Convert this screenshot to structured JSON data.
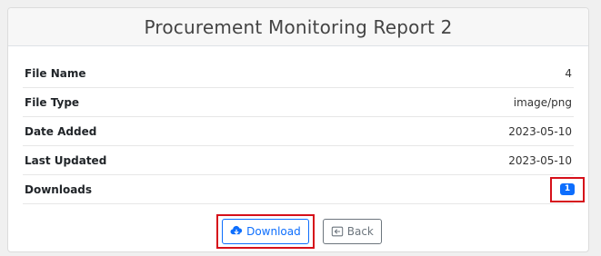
{
  "header": {
    "title": "Procurement Monitoring Report 2"
  },
  "details": [
    {
      "label": "File Name",
      "value": "4"
    },
    {
      "label": "File Type",
      "value": "image/png"
    },
    {
      "label": "Date Added",
      "value": "2023-05-10"
    },
    {
      "label": "Last Updated",
      "value": "2023-05-10"
    }
  ],
  "downloads": {
    "label": "Downloads",
    "count": "1"
  },
  "actions": {
    "download_label": "Download",
    "download_icon": "cloud-download-icon",
    "back_label": "Back",
    "back_icon": "back-arrow-icon"
  },
  "colors": {
    "highlight": "#d6101a",
    "primary": "#0d6efd",
    "secondary": "#6c757d"
  }
}
